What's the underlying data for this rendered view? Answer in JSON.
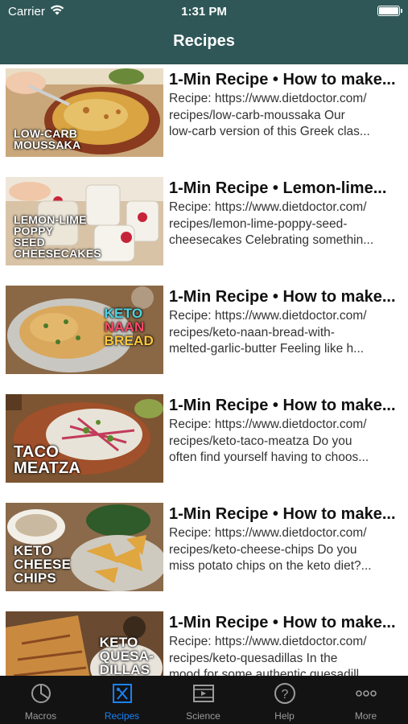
{
  "status_bar": {
    "carrier": "Carrier",
    "time": "1:31 PM"
  },
  "nav": {
    "title": "Recipes"
  },
  "recipes": [
    {
      "thumb_label": "LOW-CARB\nMOUSSAKA",
      "title": "1-Min Recipe • How to make...",
      "desc_lines": [
        "Recipe: https://www.dietdoctor.com/",
        "recipes/low-carb-moussaka Our",
        "low-carb version of this Greek clas..."
      ]
    },
    {
      "thumb_label": "LEMON-LIME\nPOPPY\nSEED\nCHEESECAKES",
      "title": "1-Min Recipe • Lemon-lime...",
      "desc_lines": [
        "Recipe: https://www.dietdoctor.com/",
        "recipes/lemon-lime-poppy-seed-",
        "cheesecakes Celebrating somethin..."
      ]
    },
    {
      "thumb_label_lines": [
        "KETO",
        "NAAN",
        "BREAD"
      ],
      "title": "1-Min Recipe • How to make...",
      "desc_lines": [
        "Recipe: https://www.dietdoctor.com/",
        "recipes/keto-naan-bread-with-",
        "melted-garlic-butter Feeling like h..."
      ]
    },
    {
      "thumb_label": "TACO\nMEATZA",
      "title": "1-Min Recipe • How to make...",
      "desc_lines": [
        "Recipe: https://www.dietdoctor.com/",
        "recipes/keto-taco-meatza Do you",
        "often find yourself having to choos..."
      ]
    },
    {
      "thumb_label": "KETO\nCHEESE\nCHIPS",
      "title": "1-Min Recipe • How to make...",
      "desc_lines": [
        "Recipe: https://www.dietdoctor.com/",
        "recipes/keto-cheese-chips Do you",
        "miss potato chips on the keto diet?..."
      ]
    },
    {
      "thumb_label": "KETO\nQUESA-\nDILLAS",
      "title": "1-Min Recipe • How to make...",
      "desc_lines": [
        "Recipe: https://www.dietdoctor.com/",
        "recipes/keto-quesadillas In the",
        "mood for some authentic quesadill..."
      ]
    }
  ],
  "tabs": [
    {
      "label": "Macros",
      "icon": "pie-chart-icon"
    },
    {
      "label": "Recipes",
      "icon": "recipes-icon",
      "active": true
    },
    {
      "label": "Science",
      "icon": "film-icon"
    },
    {
      "label": "Help",
      "icon": "help-icon"
    },
    {
      "label": "More",
      "icon": "more-icon"
    }
  ],
  "colors": {
    "header": "#2f5757",
    "tab_active": "#1a82f7",
    "tab_inactive": "#9b9b9b",
    "tabbar": "#131313"
  }
}
